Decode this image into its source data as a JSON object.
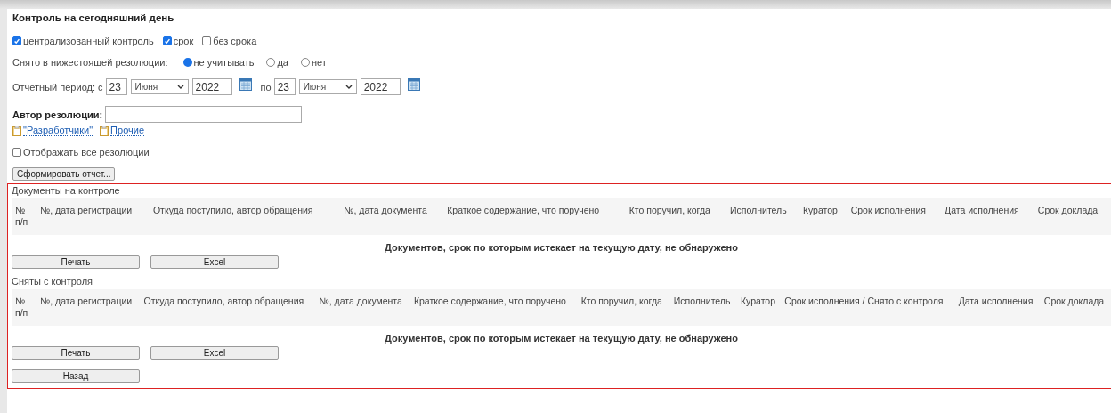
{
  "title": "Контроль на сегодняшний день",
  "filters": [
    {
      "label": "централизованный контроль",
      "checked": true
    },
    {
      "label": "срок",
      "checked": true
    },
    {
      "label": "без срока",
      "checked": false
    }
  ],
  "removed": {
    "label": "Снято в нижестоящей резолюции:",
    "options": [
      {
        "label": "не учитывать",
        "selected": true
      },
      {
        "label": "да",
        "selected": false
      },
      {
        "label": "нет",
        "selected": false
      }
    ]
  },
  "period": {
    "label": "Отчетный период: с",
    "from": {
      "day": "23",
      "month": "Июня",
      "year": "2022"
    },
    "to_label": "по",
    "to": {
      "day": "23",
      "month": "Июня",
      "year": "2022"
    }
  },
  "author": {
    "label": "Автор резолюции:",
    "links": [
      "\"Разработчики\"",
      "Прочие"
    ]
  },
  "show_all": {
    "label": "Отображать все резолюции",
    "checked": false
  },
  "report_button": "Сформировать отчет...",
  "sections": [
    {
      "title": "Документы на контроле",
      "columns": [
        "№ п/п",
        "№, дата регистрации",
        "Откуда поступило, автор обращения",
        "№, дата документа",
        "Краткое содержание, что поручено",
        "Кто поручил, когда",
        "Исполнитель",
        "Куратор",
        "Срок исполнения",
        "Дата исполнения",
        "Срок доклада"
      ],
      "message": "Документов, срок по которым истекает на текущую дату, не обнаружено",
      "buttons": [
        "Печать",
        "Excel"
      ]
    },
    {
      "title": "Сняты с контроля",
      "columns": [
        "№ п/п",
        "№, дата регистрации",
        "Откуда поступило, автор обращения",
        "№, дата документа",
        "Краткое содержание, что поручено",
        "Кто поручил, когда",
        "Исполнитель",
        "Куратор",
        "Срок исполнения / Снято с контроля",
        "Дата исполнения",
        "Срок доклада"
      ],
      "message": "Документов, срок по которым истекает на текущую дату, не обнаружено",
      "buttons": [
        "Печать",
        "Excel"
      ]
    }
  ],
  "back_button": "Назад"
}
